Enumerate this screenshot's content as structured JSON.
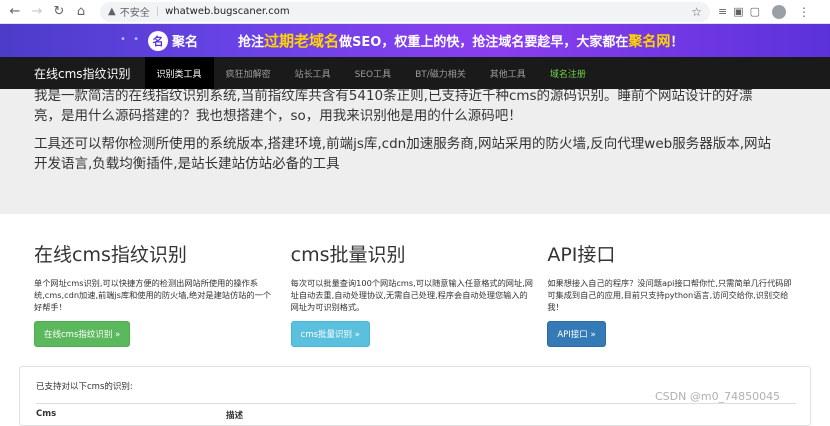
{
  "browser": {
    "insecure_label": "不安全",
    "url": "whatweb.bugscaner.com"
  },
  "banner": {
    "logo_mark": "名",
    "logo_text": "聚名",
    "slogan_a": "抢注",
    "slogan_b": "过期老域名",
    "slogan_c": "做SEO，权重上的快，抢注域名要趁早，大家都在",
    "slogan_d": "聚名网",
    "slogan_e": "！"
  },
  "site_nav": {
    "brand": "在线cms指纹识别",
    "items": [
      {
        "label": "识别类工具"
      },
      {
        "label": "疯狂加解密"
      },
      {
        "label": "站长工具"
      },
      {
        "label": "SEO工具"
      },
      {
        "label": "BT/磁力相关"
      },
      {
        "label": "其他工具"
      },
      {
        "label": "域名注册"
      }
    ]
  },
  "jumbotron": {
    "para1_line1": "我是一款简洁的在线指纹识别系统,当前指纹库共含有5410条正则,已支持近千种cms的源码识别。睡前个网站设计的好漂",
    "para1_line2": "亮，是用什么源码搭建的？我也想搭建个，so，用我来识别他是用的什么源码吧！",
    "para2_line1": "工具还可以帮你检测所使用的系统版本,搭建环境,前端js库,cdn加速服务商,网站采用的防火墙,反向代理web服务器版本,网站",
    "para2_line2": "开发语言,负载均衡插件,是站长建站仿站必备的工具"
  },
  "columns": [
    {
      "title": "在线cms指纹识别",
      "desc": "单个网址cms识别,可以快捷方便的检测出网站所使用的操作系统,cms,cdn加速,前端js库和使用的防火墙,绝对是建站仿站的一个好帮手！",
      "button": "在线cms指纹识别 »"
    },
    {
      "title": "cms批量识别",
      "desc": "每次可以批量查询100个网站cms,可以随意输入任意格式的网址,网址自动去重,自动处理协议,无需自己处理,程序会自动处理您输入的网址为可识别格式。",
      "button": "cms批量识别 »"
    },
    {
      "title": "API接口",
      "desc": "如果想接入自己的程序？没问题api接口帮你忙,只需简单几行代码即可集成到自己的应用,目前只支持python语言,访问交给你,识别交给我！",
      "button": "API接口 »"
    }
  ],
  "panel": {
    "note": "已支持对以下cms的识别:",
    "col1": "Cms",
    "col2": "描述"
  },
  "watermark": "CSDN @m0_74850045"
}
